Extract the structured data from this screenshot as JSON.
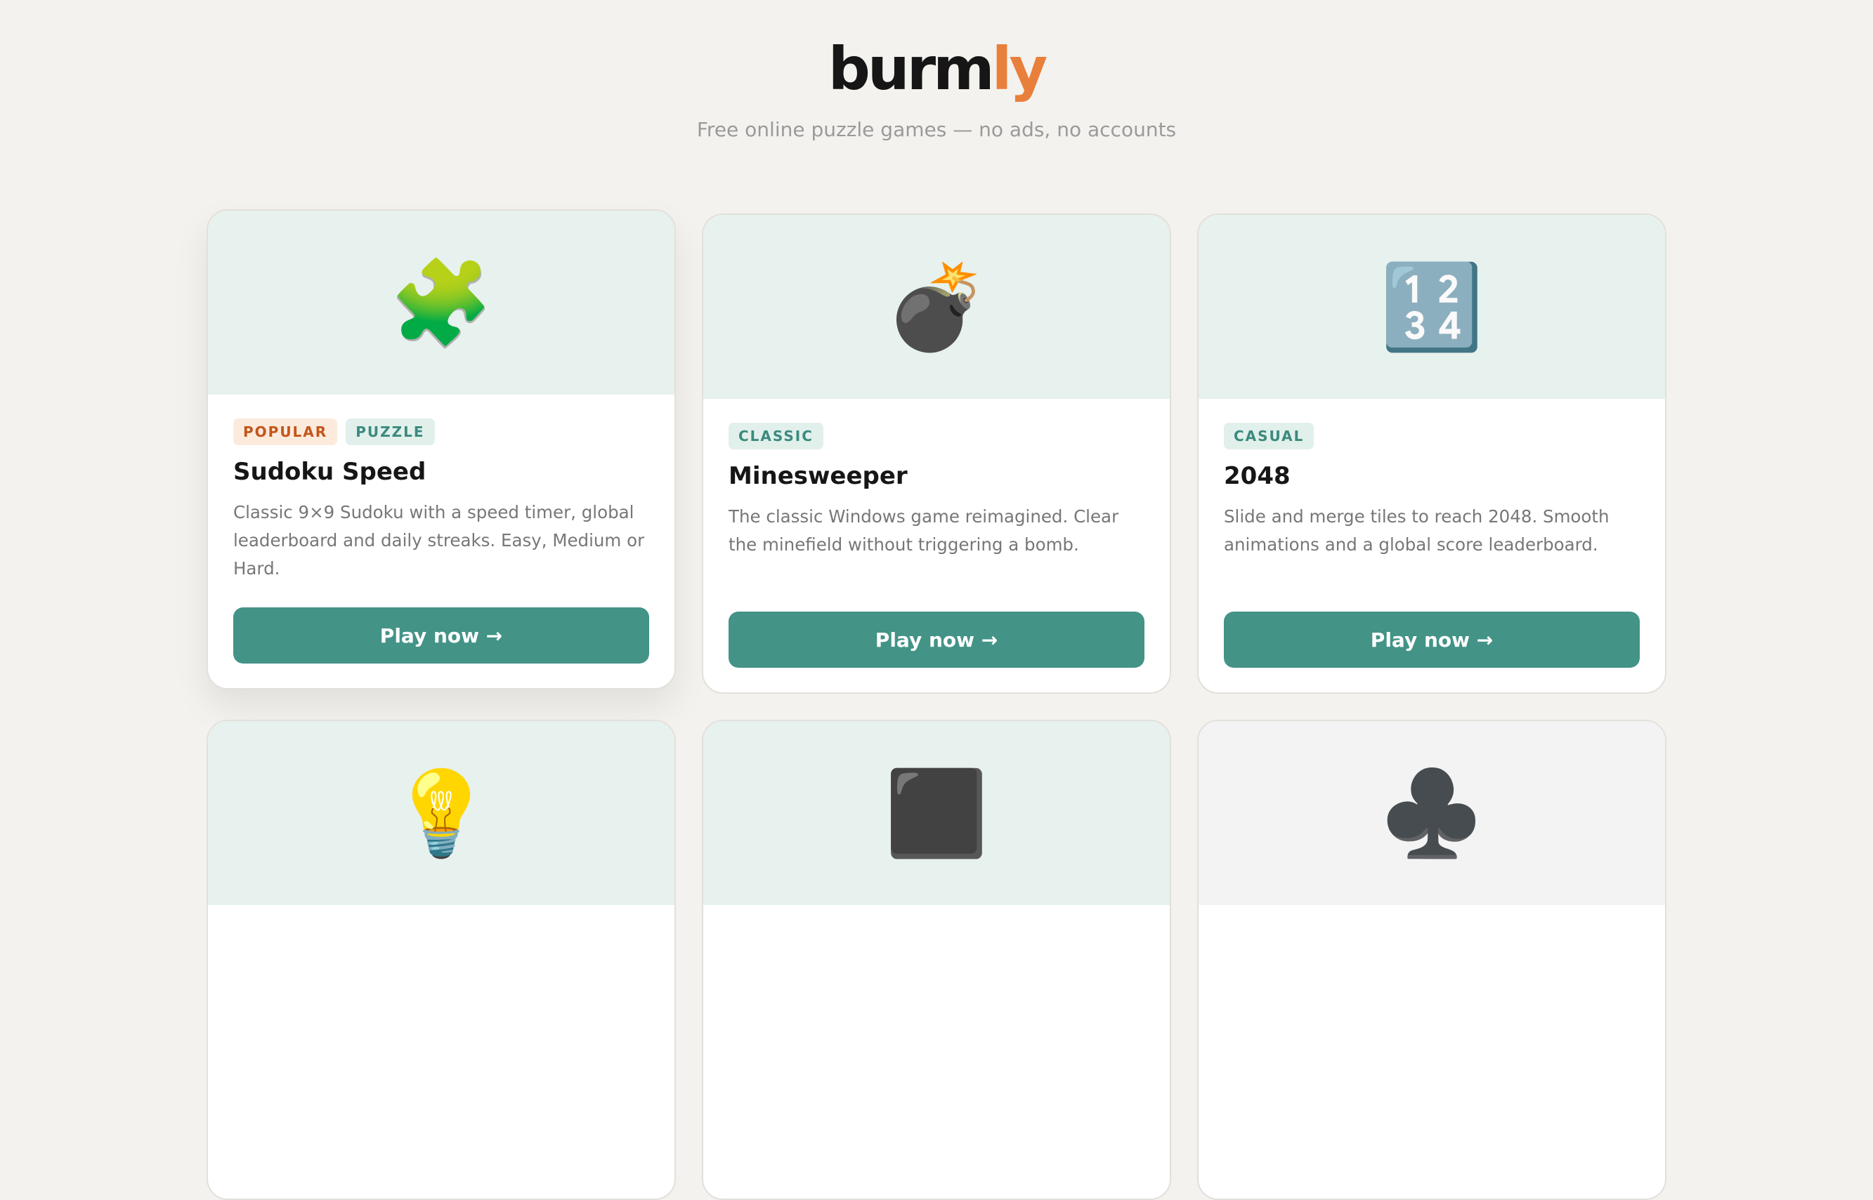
{
  "brand": {
    "name_main": "burm",
    "name_accent": "ly",
    "tagline": "Free online puzzle games — no ads, no accounts"
  },
  "cards": [
    {
      "emoji": "🧩",
      "icon": "puzzle-piece-icon",
      "badges": [
        "POPULAR",
        "PUZZLE"
      ],
      "title": "Sudoku Speed",
      "description": "Classic 9×9 Sudoku with a speed timer, global leaderboard and daily streaks. Easy, Medium or Hard.",
      "button": "Play now →"
    },
    {
      "emoji": "💣",
      "icon": "bomb-icon",
      "badges": [
        "CLASSIC"
      ],
      "title": "Minesweeper",
      "description": "The classic Windows game reimagined. Clear the minefield without triggering a bomb.",
      "button": "Play now →"
    },
    {
      "emoji": "🔢",
      "icon": "numbers-icon",
      "badges": [
        "CASUAL"
      ],
      "title": "2048",
      "description": "Slide and merge tiles to reach 2048. Smooth animations and a global score leaderboard.",
      "button": "Play now →"
    },
    {
      "emoji": "💡",
      "icon": "lightbulb-icon"
    },
    {
      "emoji": "⬛",
      "icon": "black-square-icon"
    },
    {
      "emoji": "♣️",
      "icon": "club-suit-icon"
    }
  ]
}
